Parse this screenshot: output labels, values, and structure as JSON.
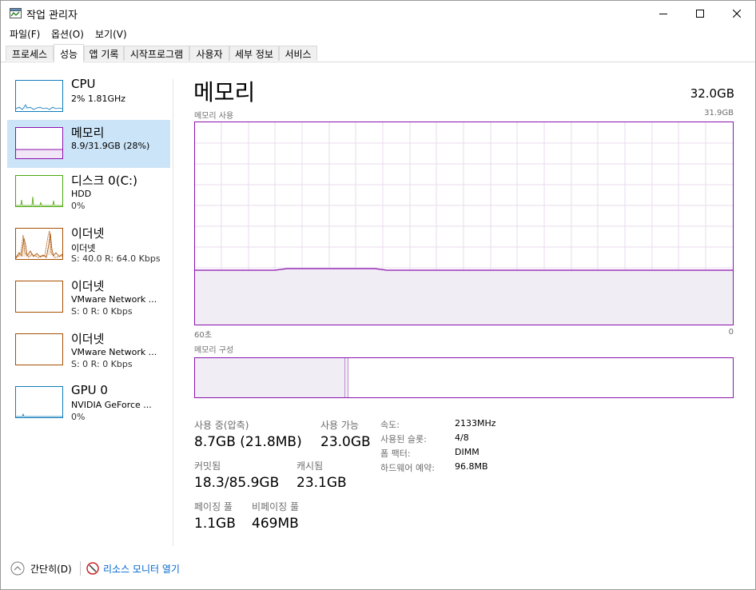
{
  "window": {
    "title": "작업 관리자"
  },
  "menu": [
    "파일(F)",
    "옵션(O)",
    "보기(V)"
  ],
  "tabs": [
    "프로세스",
    "성능",
    "앱 기록",
    "시작프로그램",
    "사용자",
    "세부 정보",
    "서비스"
  ],
  "sidebar": [
    {
      "title": "CPU",
      "line1": "2%  1.81GHz",
      "line2": "",
      "color": "#117dbb"
    },
    {
      "title": "메모리",
      "line1": "8.9/31.9GB (28%)",
      "line2": "",
      "color": "#8b12ae"
    },
    {
      "title": "디스크 0(C:)",
      "line1": "HDD",
      "line2": "0%",
      "color": "#4da60c"
    },
    {
      "title": "이더넷",
      "line1": "이더넷",
      "line2": "S: 40.0  R: 64.0 Kbps",
      "color": "#a74f01"
    },
    {
      "title": "이더넷",
      "line1": "VMware Network ...",
      "line2": "S: 0  R: 0 Kbps",
      "color": "#a74f01"
    },
    {
      "title": "이더넷",
      "line1": "VMware Network ...",
      "line2": "S: 0  R: 0 Kbps",
      "color": "#a74f01"
    },
    {
      "title": "GPU 0",
      "line1": "NVIDIA GeForce ...",
      "line2": "0%",
      "color": "#117dbb"
    }
  ],
  "main": {
    "title": "메모리",
    "total": "32.0GB",
    "usage_label": "메모리 사용",
    "usage_max": "31.9GB",
    "axis_left": "60초",
    "axis_right": "0",
    "composition_label": "메모리 구성",
    "usage_fraction": 0.28,
    "stats": {
      "in_use_label": "사용 중(압축)",
      "in_use_value": "8.7GB (21.8MB)",
      "available_label": "사용 가능",
      "available_value": "23.0GB",
      "committed_label": "커밋됨",
      "committed_value": "18.3/85.9GB",
      "cached_label": "캐시됨",
      "cached_value": "23.1GB",
      "paged_label": "페이징 풀",
      "paged_value": "1.1GB",
      "nonpaged_label": "비페이징 풀",
      "nonpaged_value": "469MB"
    },
    "details": [
      {
        "k": "속도:",
        "v": "2133MHz"
      },
      {
        "k": "사용된 슬롯:",
        "v": "4/8"
      },
      {
        "k": "폼 팩터:",
        "v": "DIMM"
      },
      {
        "k": "하드웨어 예약:",
        "v": "96.8MB"
      }
    ]
  },
  "footer": {
    "fewer_details": "간단히(D)",
    "resource_monitor": "리소스 모니터 열기"
  },
  "colors": {
    "memory": "#8b12ae",
    "selected": "#cce4f7",
    "link": "#0066cc"
  }
}
